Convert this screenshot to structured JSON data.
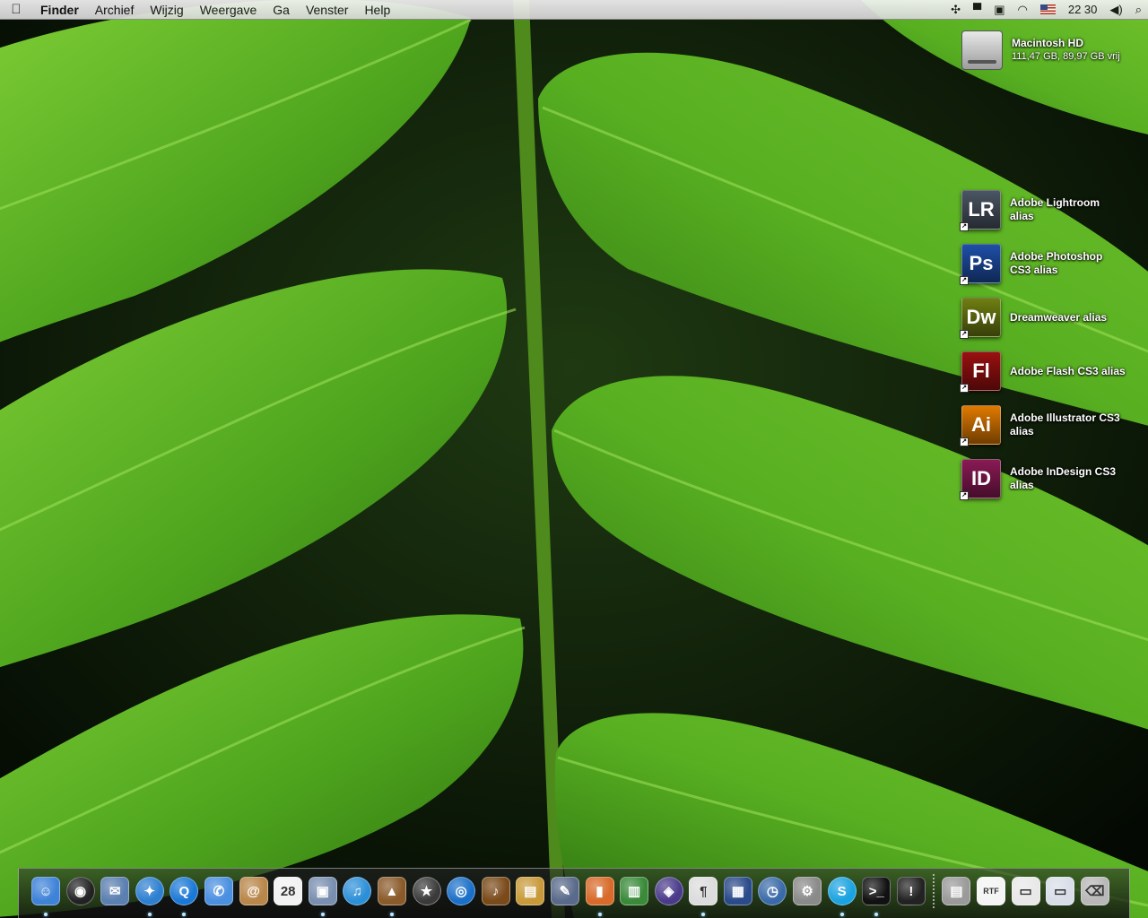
{
  "menubar": {
    "apple_label": "",
    "app_name": "Finder",
    "menus": [
      "Archief",
      "Wijzig",
      "Weergave",
      "Ga",
      "Venster",
      "Help"
    ],
    "clock": "22 30"
  },
  "desktop": {
    "hard_drive": {
      "name": "Macintosh HD",
      "info": "111,47 GB, 89,97 GB vrij"
    },
    "aliases": [
      {
        "label_1": "Adobe Lightroom",
        "label_2": "alias",
        "abbr": "LR",
        "color": "#4b5563"
      },
      {
        "label_1": "Adobe Photoshop",
        "label_2": "CS3 alias",
        "abbr": "Ps",
        "color": "#1e4fa8"
      },
      {
        "label_1": "Dreamweaver alias",
        "label_2": "",
        "abbr": "Dw",
        "color": "#6f7f12"
      },
      {
        "label_1": "Adobe Flash CS3 alias",
        "label_2": "",
        "abbr": "Fl",
        "color": "#9a1010"
      },
      {
        "label_1": "Adobe Illustrator CS3",
        "label_2": "alias",
        "abbr": "Ai",
        "color": "#e07a00"
      },
      {
        "label_1": "Adobe InDesign CS3",
        "label_2": "alias",
        "abbr": "ID",
        "color": "#8a1a55"
      }
    ]
  },
  "dock": {
    "apps": [
      {
        "icon": "finder-icon",
        "glyph": "☺",
        "color": "#3f83d8",
        "running": true
      },
      {
        "icon": "dashboard-icon",
        "glyph": "◉",
        "color": "#222222",
        "running": false,
        "round": true
      },
      {
        "icon": "mail-stamp-icon",
        "glyph": "✉",
        "color": "#5b7fb0",
        "running": false
      },
      {
        "icon": "safari-icon",
        "glyph": "✦",
        "color": "#2d7fd0",
        "running": true,
        "round": true
      },
      {
        "icon": "quicktime-icon",
        "glyph": "Q",
        "color": "#1a78d6",
        "running": true,
        "round": true
      },
      {
        "icon": "ichat-icon",
        "glyph": "✆",
        "color": "#4a8fe0",
        "running": false
      },
      {
        "icon": "address-book-icon",
        "glyph": "@",
        "color": "#b9874a",
        "running": false
      },
      {
        "icon": "ical-icon",
        "glyph": "28",
        "color": "#f2f2f2",
        "running": false,
        "dark_text": true
      },
      {
        "icon": "preview-icon",
        "glyph": "▣",
        "color": "#7a8fb0",
        "running": true
      },
      {
        "icon": "itunes-icon",
        "glyph": "♫",
        "color": "#2b8fd8",
        "running": false,
        "round": true
      },
      {
        "icon": "iphoto-icon",
        "glyph": "▲",
        "color": "#8a5a2a",
        "running": true
      },
      {
        "icon": "imovie-icon",
        "glyph": "★",
        "color": "#3a3a3a",
        "running": false,
        "round": true
      },
      {
        "icon": "idvd-icon",
        "glyph": "◎",
        "color": "#1a6fc8",
        "running": false,
        "round": true
      },
      {
        "icon": "garageband-icon",
        "glyph": "♪",
        "color": "#7a4a1a",
        "running": false
      },
      {
        "icon": "iweb-icon",
        "glyph": "▤",
        "color": "#c89a3a",
        "running": false
      },
      {
        "icon": "script-editor-icon",
        "glyph": "✎",
        "color": "#5a6a8a",
        "running": false
      },
      {
        "icon": "keynote-icon",
        "glyph": "▮",
        "color": "#d86a2a",
        "running": true
      },
      {
        "icon": "numbers-icon",
        "glyph": "▥",
        "color": "#3a8a3a",
        "running": false
      },
      {
        "icon": "front-row-icon",
        "glyph": "◈",
        "color": "#4a3a8a",
        "running": false,
        "round": true
      },
      {
        "icon": "textedit-icon",
        "glyph": "¶",
        "color": "#dcdcdc",
        "running": true,
        "dark_text": true
      },
      {
        "icon": "spaces-icon",
        "glyph": "▦",
        "color": "#2a4a8a",
        "running": false
      },
      {
        "icon": "time-machine-icon",
        "glyph": "◷",
        "color": "#3a6aa8",
        "running": false,
        "round": true
      },
      {
        "icon": "system-preferences-icon",
        "glyph": "⚙",
        "color": "#8a8a8a",
        "running": false
      },
      {
        "icon": "skype-icon",
        "glyph": "S",
        "color": "#1aa3e0",
        "running": true,
        "round": true
      },
      {
        "icon": "terminal-icon",
        "glyph": ">_",
        "color": "#111111",
        "running": true
      },
      {
        "icon": "console-icon",
        "glyph": "!",
        "color": "#222222",
        "running": false
      }
    ],
    "docs": [
      {
        "icon": "applications-stack-icon",
        "glyph": "▤",
        "color": "#9a9a9a"
      },
      {
        "icon": "rtf-document-icon",
        "glyph": "RTF",
        "color": "#f4f4f4",
        "dark_text": true
      },
      {
        "icon": "document-icon",
        "glyph": "▭",
        "color": "#e8e8e8",
        "dark_text": true
      },
      {
        "icon": "mail-window-icon",
        "glyph": "▭",
        "color": "#d8dde8",
        "dark_text": true
      },
      {
        "icon": "trash-icon",
        "glyph": "⌫",
        "color": "#b8b8b8",
        "dark_text": true
      }
    ]
  }
}
